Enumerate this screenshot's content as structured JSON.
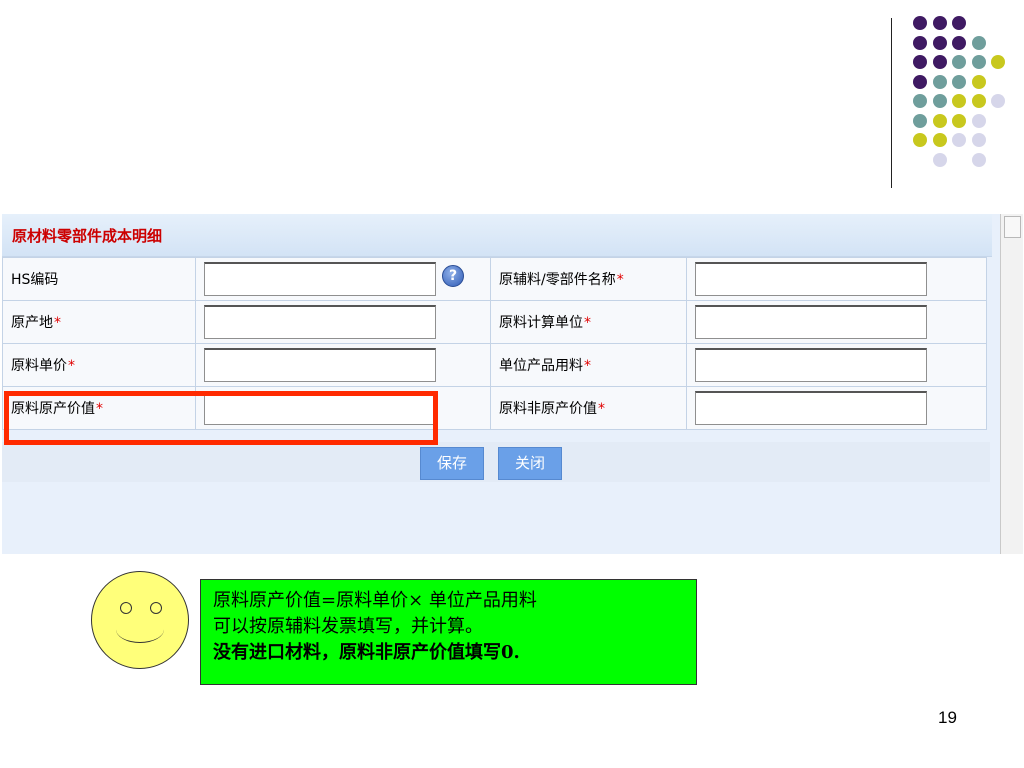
{
  "decor": {
    "dot_colors": {
      "purple": "#3f1a63",
      "teal": "#6f9e9c",
      "yellow": "#c8c81e",
      "lavender": "#d6d6ea"
    },
    "dots": [
      {
        "c": "purple",
        "r": 0,
        "k": 0
      },
      {
        "c": "purple",
        "r": 0,
        "k": 1
      },
      {
        "c": "purple",
        "r": 0,
        "k": 2
      },
      {
        "c": "purple",
        "r": 1,
        "k": 0
      },
      {
        "c": "purple",
        "r": 1,
        "k": 1
      },
      {
        "c": "purple",
        "r": 1,
        "k": 2
      },
      {
        "c": "teal",
        "r": 1,
        "k": 3
      },
      {
        "c": "purple",
        "r": 2,
        "k": 0
      },
      {
        "c": "purple",
        "r": 2,
        "k": 1
      },
      {
        "c": "teal",
        "r": 2,
        "k": 2
      },
      {
        "c": "teal",
        "r": 2,
        "k": 3
      },
      {
        "c": "yellow",
        "r": 2,
        "k": 4
      },
      {
        "c": "purple",
        "r": 3,
        "k": 0
      },
      {
        "c": "teal",
        "r": 3,
        "k": 1
      },
      {
        "c": "teal",
        "r": 3,
        "k": 2
      },
      {
        "c": "yellow",
        "r": 3,
        "k": 3
      },
      {
        "c": "teal",
        "r": 4,
        "k": 0
      },
      {
        "c": "teal",
        "r": 4,
        "k": 1
      },
      {
        "c": "yellow",
        "r": 4,
        "k": 2
      },
      {
        "c": "yellow",
        "r": 4,
        "k": 3
      },
      {
        "c": "lavender",
        "r": 4,
        "k": 4
      },
      {
        "c": "teal",
        "r": 5,
        "k": 0
      },
      {
        "c": "yellow",
        "r": 5,
        "k": 1
      },
      {
        "c": "yellow",
        "r": 5,
        "k": 2
      },
      {
        "c": "lavender",
        "r": 5,
        "k": 3
      },
      {
        "c": "yellow",
        "r": 6,
        "k": 0
      },
      {
        "c": "yellow",
        "r": 6,
        "k": 1
      },
      {
        "c": "lavender",
        "r": 6,
        "k": 2
      },
      {
        "c": "lavender",
        "r": 6,
        "k": 3
      },
      {
        "c": "lavender",
        "r": 7,
        "k": 1
      },
      {
        "c": "lavender",
        "r": 7,
        "k": 3
      }
    ]
  },
  "form": {
    "title": "原材料零部件成本明细",
    "required_mark": "*",
    "help_icon": "?",
    "rows": [
      {
        "left_label": "HS编码",
        "left_required": false,
        "left_value": "",
        "right_label": "原辅料/零部件名称",
        "right_required": true,
        "right_value": ""
      },
      {
        "left_label": "原产地",
        "left_required": true,
        "left_value": "",
        "right_label": "原料计算单位",
        "right_required": true,
        "right_value": ""
      },
      {
        "left_label": "原料单价",
        "left_required": true,
        "left_value": "",
        "right_label": "单位产品用料",
        "right_required": true,
        "right_value": ""
      },
      {
        "left_label": "原料原产价值",
        "left_required": true,
        "left_value": "",
        "right_label": "原料非原产价值",
        "right_required": true,
        "right_value": ""
      }
    ],
    "buttons": {
      "save": "保存",
      "close": "关闭"
    }
  },
  "note": {
    "line1": "原料原产价值=原料单价× 单位产品用料",
    "line2": "可以按原辅料发票填写，并计算。",
    "line3": "没有进口材料，原料非原产价值填写0."
  },
  "page_number": "19",
  "colors": {
    "highlight": "#ff2a00",
    "note_bg": "#00ff00",
    "smiley": "#ffff7a",
    "required": "#e00000"
  }
}
